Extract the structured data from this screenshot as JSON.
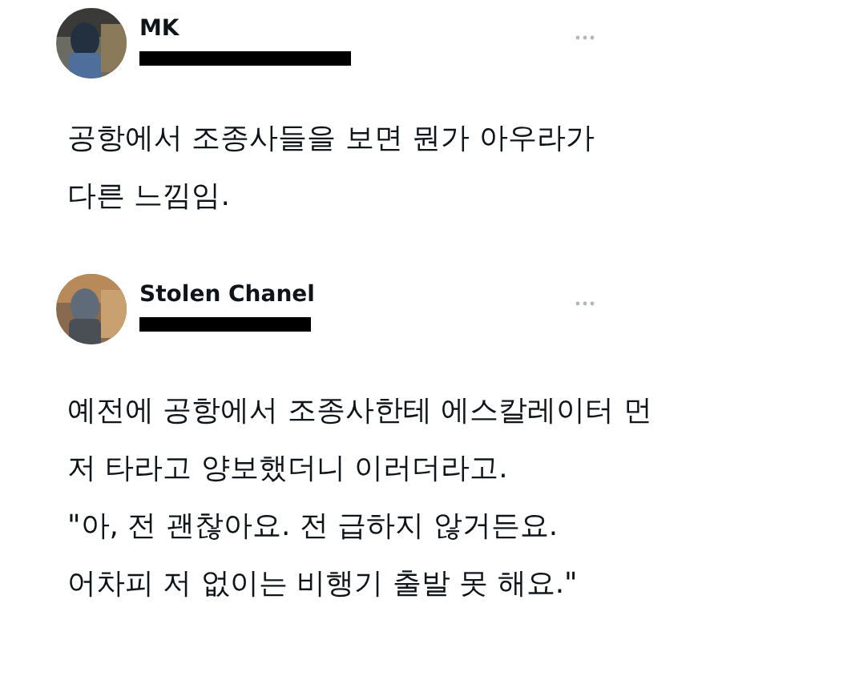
{
  "tweets": [
    {
      "name": "MK",
      "handle_redacted": true,
      "lines": [
        "공항에서 조종사들을 보면 뭔가 아우라가",
        "다른 느낌임."
      ]
    },
    {
      "name": "Stolen Chanel",
      "handle_redacted": true,
      "lines": [
        "예전에 공항에서 조종사한테 에스칼레이터 먼",
        "저 타라고 양보했더니 이러더라고.",
        "\"아, 전 괜찮아요. 전 급하지 않거든요.",
        "어차피 저 없이는 비행기 출발 못 해요.\""
      ]
    }
  ]
}
